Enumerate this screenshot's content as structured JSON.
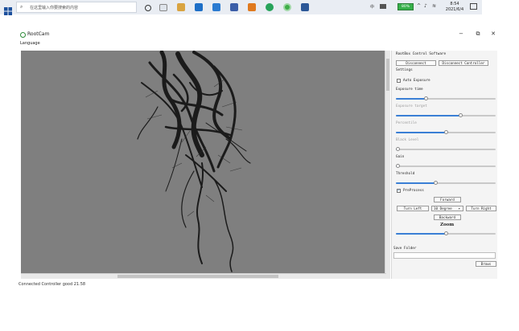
{
  "window": {
    "title": "RootCam",
    "minimize": "−",
    "maximize": "⧉",
    "close": "✕"
  },
  "menu": {
    "language": "Language"
  },
  "panel": {
    "header": "RootBox Control Software",
    "disconnect_button": "Disconnect",
    "disconnect_controller_button": "Disconnect Controller",
    "settings_label": "Settings",
    "auto_exposure_label": "Auto Exposure",
    "exposure_time_label": "Exposure time",
    "exposure_target_label": "Exposure target",
    "percentile_label": "Percentile",
    "black_level_label": "Black Level",
    "gain_label": "Gain",
    "threshold_label": "Threshold",
    "preprocess_label": "PreProcess",
    "forward_button": "Forward",
    "turn_left_button": "Turn Left",
    "degrees_select": "10 Degree",
    "turn_right_button": "Turn Right",
    "backward_button": "Backward",
    "zoom_label": "Zoom",
    "save_folder_label": "Save Folder",
    "browse_button": "Brows",
    "auto_exposure_checked": false,
    "preprocess_checked": true,
    "exposure_time_level": 0.3,
    "exposure_target_level": 0.65,
    "percentile_level": 0.5,
    "black_level_level": 0.02,
    "gain_level": 0.02,
    "threshold_level": 0.4,
    "zoom_level": 0.5
  },
  "status": {
    "text": "Connected Controller good  21.58"
  },
  "taskbar": {
    "search_placeholder": "在这里输入你要搜索的内容",
    "time": "8:54",
    "date": "2021/6/4",
    "lang": "中",
    "battery": "80%"
  },
  "colors": {
    "accent": "#3a7fd5",
    "viewport_bg": "#7f7f7f",
    "taskbar_bg": "#e9edf3"
  }
}
